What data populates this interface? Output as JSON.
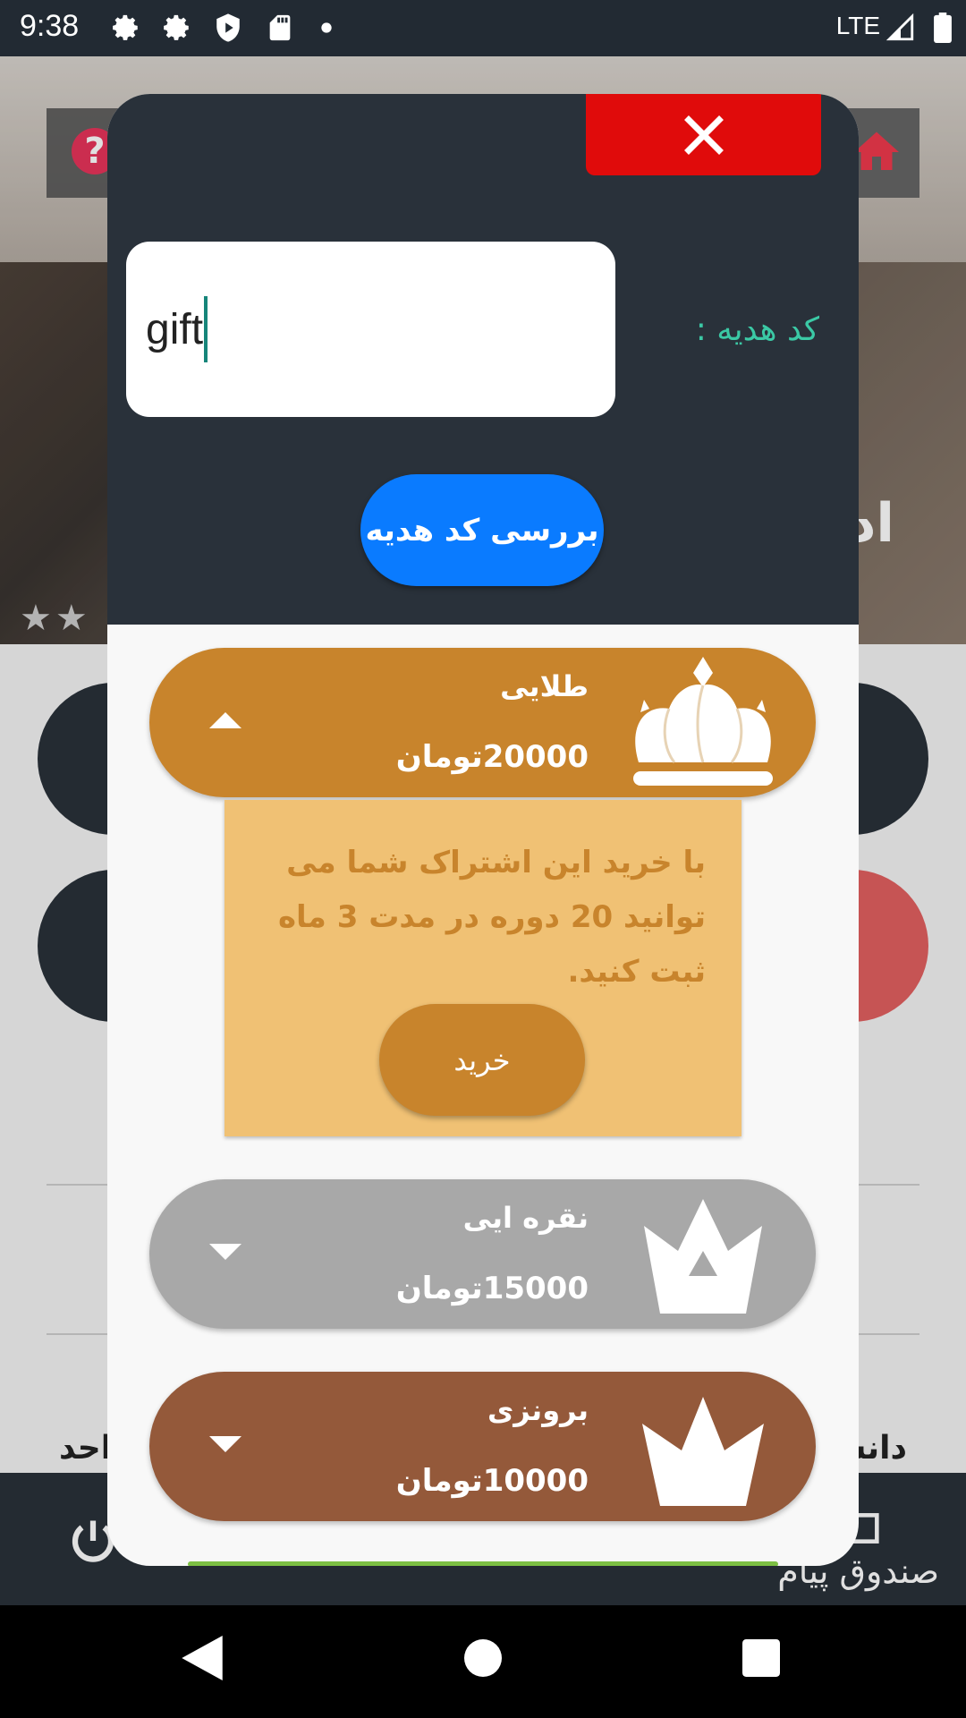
{
  "status_bar": {
    "time": "9:38",
    "network": "LTE",
    "icons": [
      "gear-icon",
      "gear-icon",
      "shield-icon",
      "sd-card-icon",
      "dot-icon",
      "signal-icon",
      "battery-icon"
    ]
  },
  "background": {
    "heading_fragment": "اد",
    "left_text": "احد",
    "right_text": "دانش",
    "bottom_nav_label": "صندوق پیام"
  },
  "dialog": {
    "close_icon": "close-icon",
    "gift_label": "کد هدیه :",
    "gift_input_value": "gift",
    "check_button": "بررسی کد هدیه",
    "plans": [
      {
        "name": "طلایی",
        "price": "20000تومان",
        "color": "#c8842c",
        "expanded": true,
        "description": "با خرید این اشتراک شما می توانید 20 دوره در مدت 3 ماه ثبت کنید.",
        "buy_label": "خرید"
      },
      {
        "name": "نقره ایی",
        "price": "15000تومان",
        "color": "#a8a8a8",
        "expanded": false
      },
      {
        "name": "برونزی",
        "price": "10000تومان",
        "color": "#94593a",
        "expanded": false
      }
    ]
  },
  "colors": {
    "dialog_header": "#29313a",
    "close_button": "#e00b0b",
    "check_button": "#0a7bff",
    "gift_label": "#3bc9a5",
    "details_bg": "#f0c174"
  }
}
